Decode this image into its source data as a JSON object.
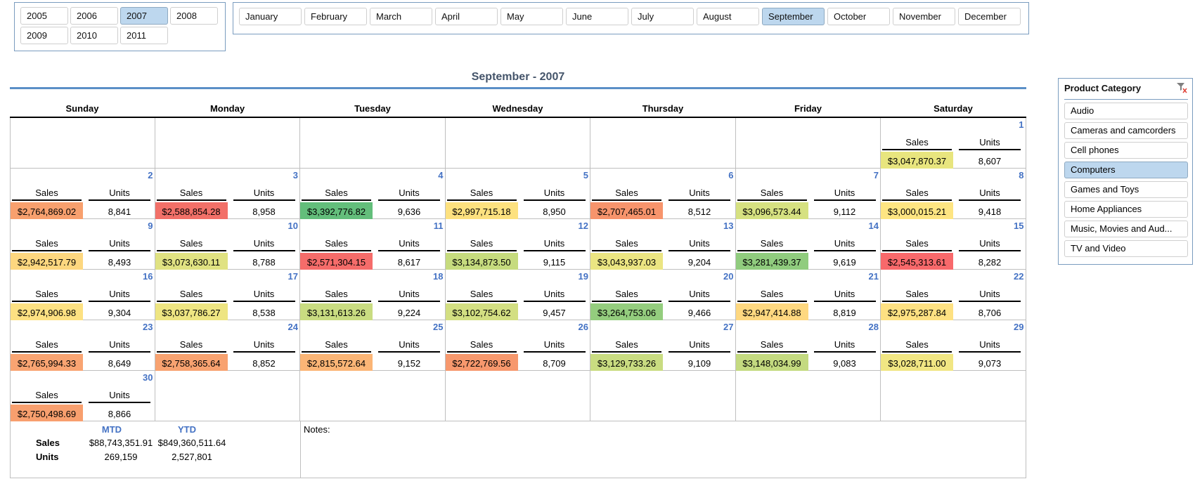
{
  "years": {
    "items": [
      "2005",
      "2006",
      "2007",
      "2008",
      "2009",
      "2010",
      "2011"
    ],
    "selected": "2007"
  },
  "months": {
    "items": [
      "January",
      "February",
      "March",
      "April",
      "May",
      "June",
      "July",
      "August",
      "September",
      "October",
      "November",
      "December"
    ],
    "selected": "September"
  },
  "calendar": {
    "title": "September - 2007",
    "weekdays": [
      "Sunday",
      "Monday",
      "Tuesday",
      "Wednesday",
      "Thursday",
      "Friday",
      "Saturday"
    ],
    "sales_label": "Sales",
    "units_label": "Units",
    "days": [
      {
        "day": "1",
        "sales": "$3,047,870.37",
        "units": "8,607",
        "color": "#e8e57e"
      },
      {
        "day": "2",
        "sales": "$2,764,869.02",
        "units": "8,841",
        "color": "#f8a06e"
      },
      {
        "day": "3",
        "sales": "$2,588,854.28",
        "units": "8,958",
        "color": "#f27068"
      },
      {
        "day": "4",
        "sales": "$3,392,776.82",
        "units": "9,636",
        "color": "#63be7b"
      },
      {
        "day": "5",
        "sales": "$2,997,715.18",
        "units": "8,950",
        "color": "#fde17f"
      },
      {
        "day": "6",
        "sales": "$2,707,465.01",
        "units": "8,512",
        "color": "#f7946c"
      },
      {
        "day": "7",
        "sales": "$3,096,573.44",
        "units": "9,112",
        "color": "#d6e181"
      },
      {
        "day": "8",
        "sales": "$3,000,015.21",
        "units": "9,418",
        "color": "#fee582"
      },
      {
        "day": "9",
        "sales": "$2,942,517.79",
        "units": "8,493",
        "color": "#fdd77f"
      },
      {
        "day": "10",
        "sales": "$3,073,630.11",
        "units": "8,788",
        "color": "#e0e282"
      },
      {
        "day": "11",
        "sales": "$2,571,304.15",
        "units": "8,617",
        "color": "#f56c6a"
      },
      {
        "day": "12",
        "sales": "$3,134,873.50",
        "units": "9,115",
        "color": "#c6db7e"
      },
      {
        "day": "13",
        "sales": "$3,043,937.03",
        "units": "9,204",
        "color": "#ebe582"
      },
      {
        "day": "14",
        "sales": "$3,281,439.37",
        "units": "9,619",
        "color": "#90cc7e"
      },
      {
        "day": "15",
        "sales": "$2,545,313.61",
        "units": "8,282",
        "color": "#f8696b"
      },
      {
        "day": "16",
        "sales": "$2,974,906.98",
        "units": "9,304",
        "color": "#fde182"
      },
      {
        "day": "17",
        "sales": "$3,037,786.27",
        "units": "8,538",
        "color": "#eee582"
      },
      {
        "day": "18",
        "sales": "$3,131,613.26",
        "units": "9,224",
        "color": "#c9dc81"
      },
      {
        "day": "19",
        "sales": "$3,102,754.62",
        "units": "9,457",
        "color": "#d3df82"
      },
      {
        "day": "20",
        "sales": "$3,264,753.06",
        "units": "9,466",
        "color": "#94cd7e"
      },
      {
        "day": "21",
        "sales": "$2,947,414.88",
        "units": "8,819",
        "color": "#fed880"
      },
      {
        "day": "22",
        "sales": "$2,975,287.84",
        "units": "8,706",
        "color": "#fee182"
      },
      {
        "day": "23",
        "sales": "$2,765,994.33",
        "units": "8,649",
        "color": "#f9a472"
      },
      {
        "day": "24",
        "sales": "$2,758,365.64",
        "units": "8,852",
        "color": "#f8a270"
      },
      {
        "day": "25",
        "sales": "$2,815,572.64",
        "units": "9,152",
        "color": "#fbb576"
      },
      {
        "day": "26",
        "sales": "$2,722,769.56",
        "units": "8,709",
        "color": "#f7986d"
      },
      {
        "day": "27",
        "sales": "$3,129,733.26",
        "units": "9,109",
        "color": "#c9dc81"
      },
      {
        "day": "28",
        "sales": "$3,148,034.99",
        "units": "9,083",
        "color": "#c4da80"
      },
      {
        "day": "29",
        "sales": "$3,028,711.00",
        "units": "9,073",
        "color": "#f1e683"
      },
      {
        "day": "30",
        "sales": "$2,750,498.69",
        "units": "8,866",
        "color": "#f89f6e"
      }
    ],
    "first_weekday_index": 6
  },
  "summary": {
    "mtd_label": "MTD",
    "ytd_label": "YTD",
    "sales_label": "Sales",
    "units_label": "Units",
    "mtd_sales": "$88,743,351.91",
    "ytd_sales": "$849,360,511.64",
    "mtd_units": "269,159",
    "ytd_units": "2,527,801",
    "notes_label": "Notes:"
  },
  "category_slicer": {
    "title": "Product Category",
    "items": [
      "Audio",
      "Cameras and camcorders",
      "Cell phones",
      "Computers",
      "Games and Toys",
      "Home Appliances",
      "Music, Movies and Aud...",
      "TV and Video"
    ],
    "selected": "Computers",
    "clear_filter_icon": "clear-filter-icon"
  }
}
